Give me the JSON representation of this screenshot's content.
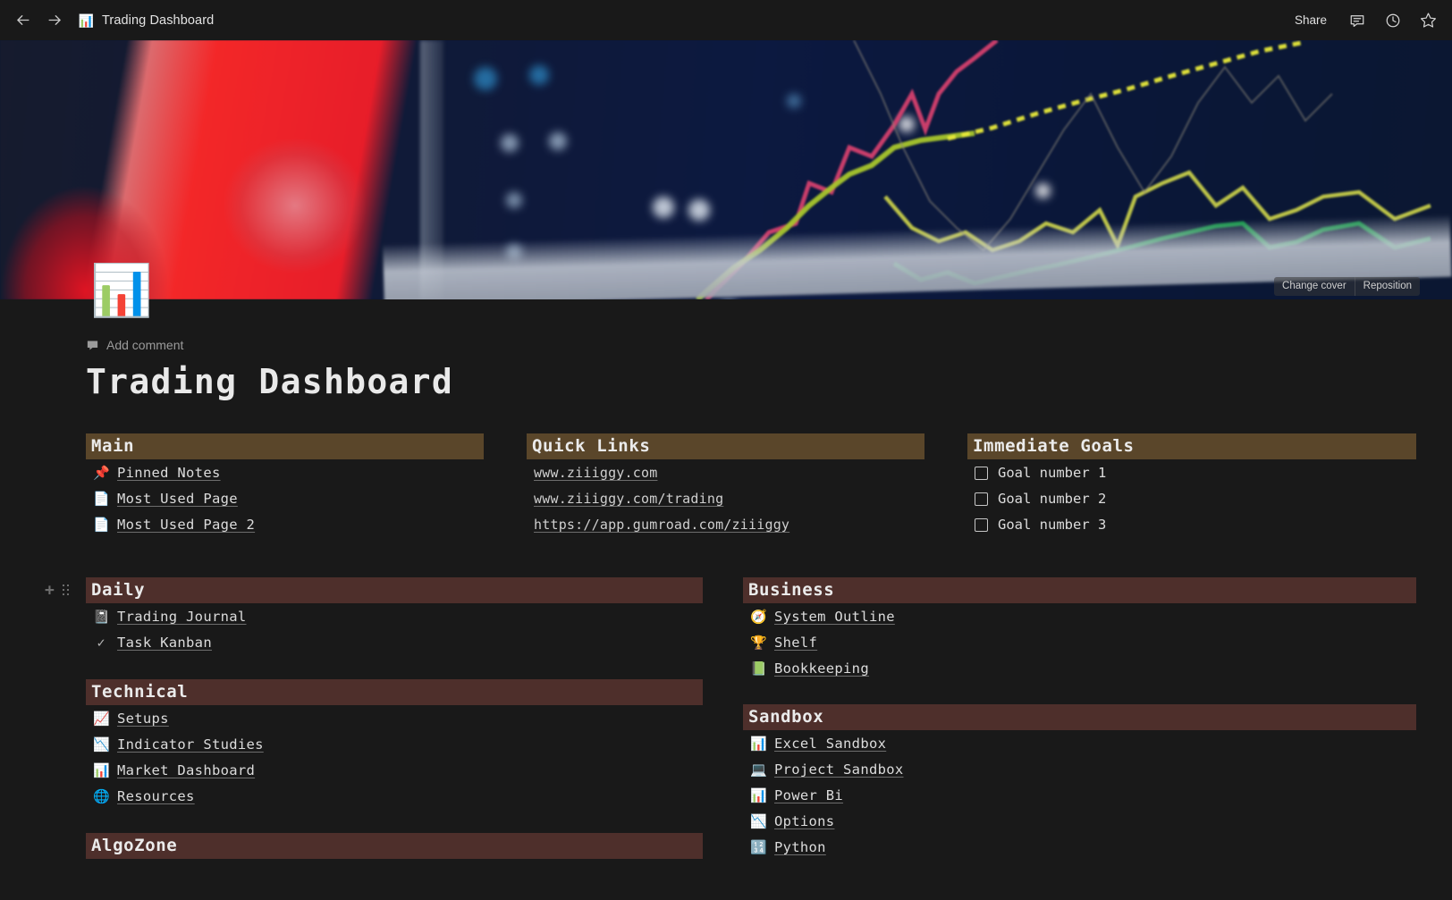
{
  "topbar": {
    "back_icon": "arrow-left-icon",
    "forward_icon": "arrow-right-icon",
    "breadcrumb_icon": "bar-chart-icon",
    "breadcrumb_title": "Trading Dashboard",
    "share_label": "Share",
    "comment_icon": "comment-icon",
    "history_icon": "clock-icon",
    "favorite_icon": "star-icon"
  },
  "cover": {
    "change_cover_label": "Change cover",
    "reposition_label": "Reposition",
    "colors": {
      "background": "#0c1940",
      "red_blur": "#e81422",
      "magenta_line": "#d9416f",
      "yellow_line": "#e8ea3a",
      "green_line": "#16a04a",
      "olive_line": "#a8c62c"
    }
  },
  "page": {
    "icon": "bar-chart-icon",
    "add_comment_label": "Add comment",
    "title": "Trading Dashboard",
    "background": "#191919",
    "header_olive": "#5a462a",
    "header_rust": "#4e2f2b"
  },
  "sections": {
    "main": {
      "title": "Main",
      "items": [
        {
          "emoji": "📌",
          "icon_name": "pushpin-icon",
          "label": "Pinned Notes"
        },
        {
          "emoji": "📄",
          "icon_name": "page-icon",
          "label": "Most Used Page"
        },
        {
          "emoji": "📄",
          "icon_name": "page-icon",
          "label": "Most Used Page 2"
        }
      ]
    },
    "quick_links": {
      "title": "Quick Links",
      "links": [
        "www.ziiiggy.com",
        "www.ziiiggy.com/trading",
        "https://app.gumroad.com/ziiiggy"
      ]
    },
    "immediate_goals": {
      "title": "Immediate Goals",
      "todos": [
        {
          "label": "Goal number 1",
          "checked": false
        },
        {
          "label": "Goal number 2",
          "checked": false
        },
        {
          "label": "Goal number 3",
          "checked": false
        }
      ]
    },
    "daily": {
      "title": "Daily",
      "items": [
        {
          "emoji": "📓",
          "icon_name": "notebook-icon",
          "label": "Trading Journal"
        },
        {
          "emoji": "✓",
          "icon_name": "check-icon",
          "label": "Task Kanban"
        }
      ]
    },
    "technical": {
      "title": "Technical",
      "items": [
        {
          "emoji": "📈",
          "icon_name": "chart-increasing-icon",
          "label": "Setups"
        },
        {
          "emoji": "📉",
          "icon_name": "chart-decreasing-icon",
          "label": "Indicator Studies"
        },
        {
          "emoji": "📊",
          "icon_name": "bar-chart-icon",
          "label": "Market Dashboard"
        },
        {
          "emoji": "🌐",
          "icon_name": "globe-icon",
          "label": "Resources"
        }
      ]
    },
    "algozone": {
      "title": "AlgoZone"
    },
    "business": {
      "title": "Business",
      "items": [
        {
          "emoji": "🧭",
          "icon_name": "compass-icon",
          "label": "System Outline"
        },
        {
          "emoji": "🏆",
          "icon_name": "trophy-icon",
          "label": "Shelf"
        },
        {
          "emoji": "📗",
          "icon_name": "green-book-icon",
          "label": "Bookkeeping"
        }
      ]
    },
    "sandbox": {
      "title": "Sandbox",
      "items": [
        {
          "emoji": "📊",
          "icon_name": "bar-chart-icon",
          "label": "Excel Sandbox"
        },
        {
          "emoji": "💻",
          "icon_name": "laptop-icon",
          "label": "Project Sandbox"
        },
        {
          "emoji": "📊",
          "icon_name": "bar-chart-icon",
          "label": "Power Bi"
        },
        {
          "emoji": "📉",
          "icon_name": "chart-decreasing-icon",
          "label": "Options"
        },
        {
          "emoji": "🔢",
          "icon_name": "input-numbers-icon",
          "label": "Python"
        }
      ]
    }
  }
}
